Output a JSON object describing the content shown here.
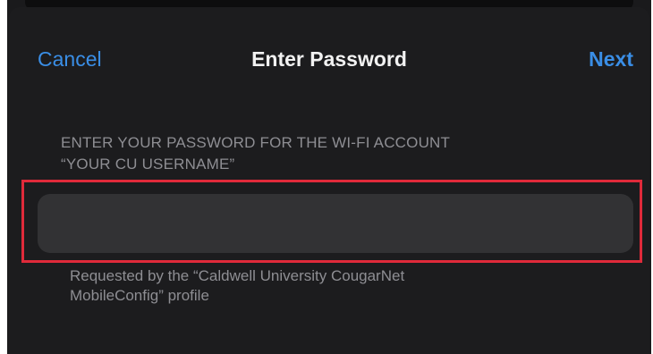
{
  "nav": {
    "cancel_label": "Cancel",
    "title": "Enter Password",
    "next_label": "Next"
  },
  "section": {
    "header_line1": "ENTER YOUR PASSWORD FOR THE WI-FI ACCOUNT",
    "header_line2": "“YOUR CU USERNAME”"
  },
  "password_field": {
    "value": "",
    "placeholder": ""
  },
  "footer": {
    "line1": "Requested by the “Caldwell University CougarNet",
    "line2": "MobileConfig” profile"
  },
  "colors": {
    "accent": "#3a8ee6",
    "background": "#1c1c1e",
    "field": "#323234",
    "highlight": "#e02a3a",
    "secondary_text": "#8e8e93"
  }
}
